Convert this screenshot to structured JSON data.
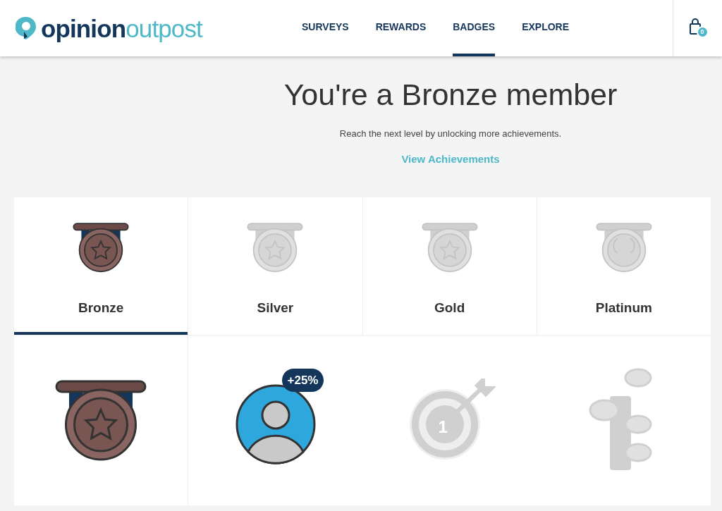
{
  "logo": {
    "part_1": "opinion",
    "part_2": "outpost"
  },
  "nav": [
    {
      "label": "SURVEYS",
      "selected": false
    },
    {
      "label": "REWARDS",
      "selected": false
    },
    {
      "label": "BADGES",
      "selected": true
    },
    {
      "label": "EXPLORE",
      "selected": false
    }
  ],
  "cart": {
    "count": "0"
  },
  "hero": {
    "title": "You're a Bronze member",
    "subtitle": "Reach the next level by unlocking more achievements.",
    "link": "View Achievements"
  },
  "tiers": [
    {
      "name": "Bronze",
      "selected": true,
      "unlocked": true,
      "kind": "star"
    },
    {
      "name": "Silver",
      "selected": false,
      "unlocked": false,
      "kind": "star"
    },
    {
      "name": "Gold",
      "selected": false,
      "unlocked": false,
      "kind": "star"
    },
    {
      "name": "Platinum",
      "selected": false,
      "unlocked": false,
      "kind": "laurel"
    }
  ],
  "badges": [
    {
      "kind": "medal",
      "unlocked": true
    },
    {
      "kind": "profile",
      "unlocked": true,
      "tag": "+25%"
    },
    {
      "kind": "target",
      "unlocked": false,
      "number": "1"
    },
    {
      "kind": "coins",
      "unlocked": false
    }
  ]
}
